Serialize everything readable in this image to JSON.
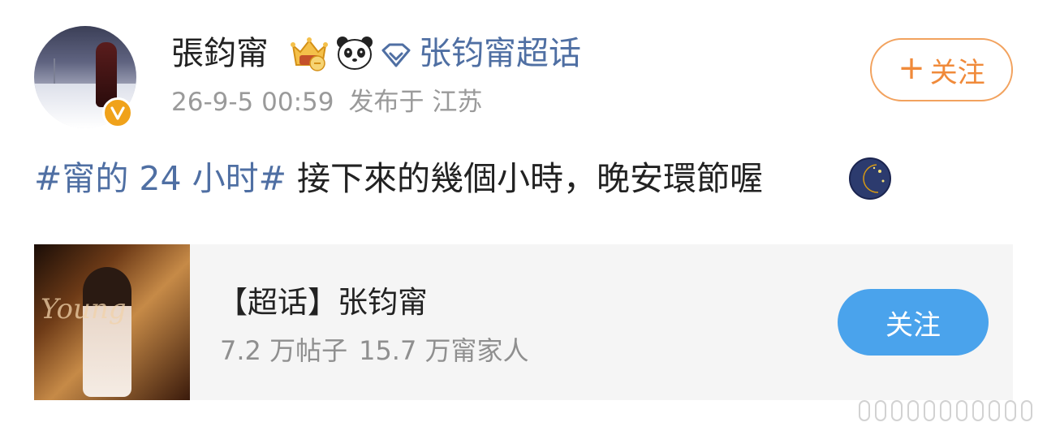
{
  "post": {
    "author": {
      "name": "張鈞甯",
      "verified_color": "#f0a21b"
    },
    "badges": [
      "crown-level-badge-icon",
      "panda-badge-icon",
      "diamond-icon"
    ],
    "supertopic_link": "张钧甯超话",
    "timestamp": "26-9-5 00:59",
    "location": "发布于 江苏",
    "follow_button": {
      "plus": "+",
      "label": "关注"
    },
    "content": {
      "hashtag": "#甯的 24 小时#",
      "text": " 接下來的幾個小時，晚安環節喔",
      "emoji": "moon-emoji"
    }
  },
  "card": {
    "title": "【超话】张钧甯",
    "posts": "7.2 万帖子",
    "members": "15.7 万甯家人",
    "follow_label": "关注",
    "image": {
      "overlay_text": "Young"
    }
  },
  "colors": {
    "link": "#4f6fa3",
    "follow_orange": "#f08a3a",
    "card_button": "#4aa3ec",
    "card_bg": "#f5f5f5"
  }
}
